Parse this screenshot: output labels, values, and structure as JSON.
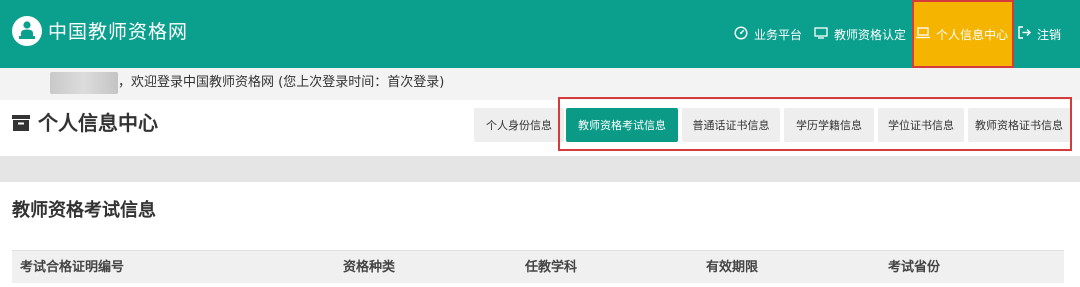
{
  "header": {
    "brand": "中国教师资格网",
    "nav": [
      {
        "label": "业务平台",
        "icon": "dashboard-icon"
      },
      {
        "label": "教师资格认定",
        "icon": "monitor-icon"
      },
      {
        "label": "个人信息中心",
        "icon": "laptop-icon",
        "active": true
      },
      {
        "label": "注销",
        "icon": "logout-icon"
      }
    ],
    "accent_color": "#0ba08d",
    "active_color": "#f4b400"
  },
  "welcome": {
    "text": "，欢迎登录中国教师资格网 (您上次登录时间：首次登录)"
  },
  "page": {
    "title": "个人信息中心",
    "title_icon": "archive-box-icon"
  },
  "tabs": [
    {
      "label": "个人身份信息"
    },
    {
      "label": "教师资格考试信息",
      "active": true
    },
    {
      "label": "普通话证书信息"
    },
    {
      "label": "学历学籍信息"
    },
    {
      "label": "学位证书信息"
    },
    {
      "label": "教师资格证书信息"
    }
  ],
  "section": {
    "title": "教师资格考试信息",
    "columns": [
      "考试合格证明编号",
      "资格种类",
      "任教学科",
      "有效期限",
      "考试省份"
    ]
  }
}
